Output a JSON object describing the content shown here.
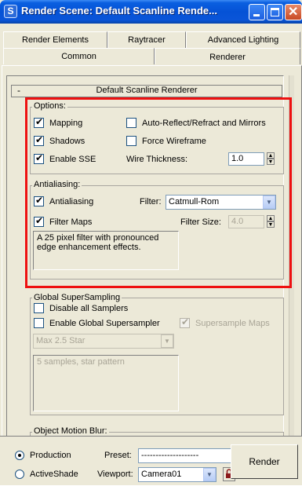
{
  "window": {
    "title": "Render Scene: Default Scanline Rende...",
    "app_icon": "S"
  },
  "tabs": {
    "row1": [
      "Render Elements",
      "Raytracer",
      "Advanced Lighting"
    ],
    "row2": [
      "Common",
      "Renderer"
    ],
    "active": "Renderer"
  },
  "rollout": {
    "toggle": "-",
    "title": "Default Scanline Renderer"
  },
  "options": {
    "legend": "Options:",
    "mapping": "Mapping",
    "auto_reflect": "Auto-Reflect/Refract and Mirrors",
    "shadows": "Shadows",
    "force_wireframe": "Force Wireframe",
    "enable_sse": "Enable SSE",
    "wire_thickness_label": "Wire Thickness:",
    "wire_thickness_value": "1.0"
  },
  "antialiasing": {
    "legend": "Antialiasing:",
    "antialiasing": "Antialiasing",
    "filter_label": "Filter:",
    "filter_value": "Catmull-Rom",
    "filter_maps": "Filter Maps",
    "filter_size_label": "Filter Size:",
    "filter_size_value": "4.0",
    "description": "A 25 pixel filter with pronounced edge enhancement effects."
  },
  "supersampling": {
    "legend": "Global SuperSampling",
    "disable_all": "Disable all Samplers",
    "enable_global": "Enable Global Supersampler",
    "supersample_maps": "Supersample Maps",
    "sampler_value": "Max 2.5 Star",
    "description": "5 samples, star pattern"
  },
  "motion_blur": {
    "legend": "Object Motion Blur:"
  },
  "bottom": {
    "production": "Production",
    "activeshade": "ActiveShade",
    "preset_label": "Preset:",
    "preset_value": "--------------------",
    "viewport_label": "Viewport:",
    "viewport_value": "Camera01",
    "render": "Render"
  },
  "colors": {
    "highlight": "#ee1111",
    "titlebar": "#0552d6"
  }
}
